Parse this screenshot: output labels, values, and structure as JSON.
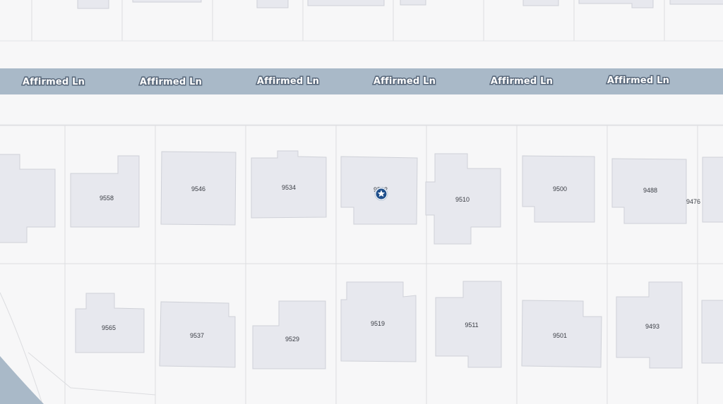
{
  "street": {
    "name": "Affirmed Ln",
    "road_color": "#a9b9c8"
  },
  "colors": {
    "background": "#f7f7f8",
    "building": "#e7e8ee",
    "parcel_line": "#dcdde0",
    "water": "#a9b9c8",
    "marker": "#1f4f8c"
  },
  "north_lots": [
    "9558",
    "9546",
    "9534",
    "9522",
    "9510",
    "9500",
    "9488"
  ],
  "south_lots": [
    "9565",
    "9537",
    "9529",
    "9519",
    "9511",
    "9501",
    "9493"
  ],
  "selected_lot": {
    "address": "9522",
    "marker_icon": "star-pin-icon"
  },
  "edge_lot_address": "9476"
}
